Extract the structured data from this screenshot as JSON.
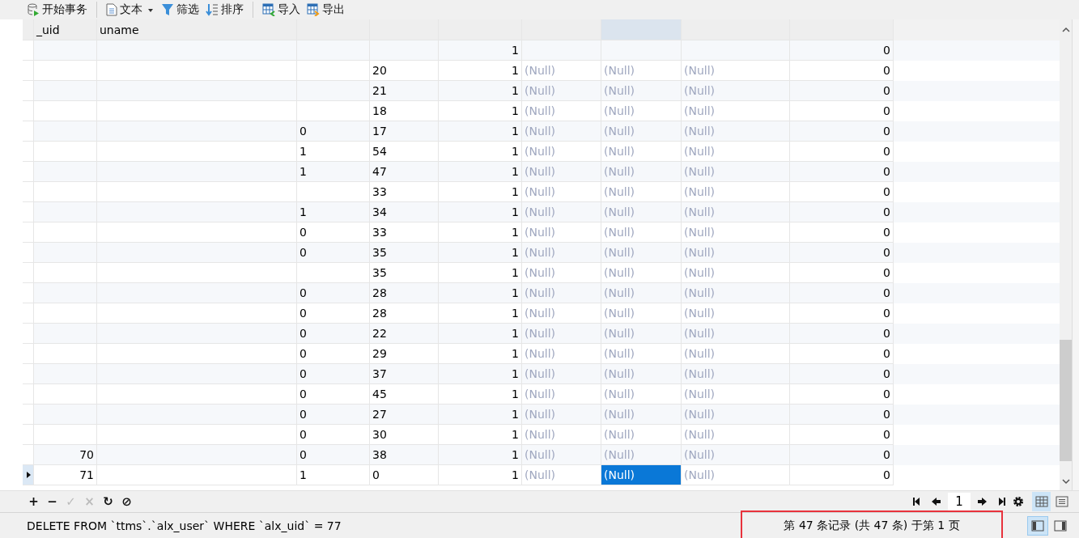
{
  "toolbar": [
    {
      "label": "开始事务"
    },
    {
      "label": "文本"
    },
    {
      "label": "筛选"
    },
    {
      "label": "排序"
    },
    {
      "label": "导入"
    },
    {
      "label": "导出"
    }
  ],
  "table": {
    "columns": [
      {
        "header": "_uid",
        "kind": "plain",
        "selected": false
      },
      {
        "header": "uname",
        "kind": "plain",
        "selected": false
      },
      {
        "kind": "plain",
        "selected": false
      },
      {
        "kind": "plain",
        "selected": false
      },
      {
        "kind": "plain",
        "selected": false
      },
      {
        "kind": "null",
        "selected": false
      },
      {
        "kind": "null",
        "selected": true
      },
      {
        "kind": "null",
        "selected": false
      },
      {
        "kind": "plain",
        "selected": false
      }
    ],
    "rows": [
      {
        "selected": false,
        "cells": [
          null,
          null,
          null,
          null,
          "1",
          null,
          null,
          null,
          "0"
        ]
      },
      {
        "selected": false,
        "cells": [
          null,
          null,
          null,
          "20",
          "1",
          "(Null)",
          "(Null)",
          "(Null)",
          "0"
        ]
      },
      {
        "selected": false,
        "cells": [
          null,
          null,
          null,
          "21",
          "1",
          "(Null)",
          "(Null)",
          "(Null)",
          "0"
        ]
      },
      {
        "selected": false,
        "cells": [
          null,
          null,
          null,
          "18",
          "1",
          "(Null)",
          "(Null)",
          "(Null)",
          "0"
        ]
      },
      {
        "selected": false,
        "cells": [
          null,
          null,
          "0",
          "17",
          "1",
          "(Null)",
          "(Null)",
          "(Null)",
          "0"
        ]
      },
      {
        "selected": false,
        "cells": [
          null,
          null,
          "1",
          "54",
          "1",
          "(Null)",
          "(Null)",
          "(Null)",
          "0"
        ]
      },
      {
        "selected": false,
        "cells": [
          null,
          null,
          "1",
          "47",
          "1",
          "(Null)",
          "(Null)",
          "(Null)",
          "0"
        ]
      },
      {
        "selected": false,
        "cells": [
          null,
          null,
          null,
          "33",
          "1",
          "(Null)",
          "(Null)",
          "(Null)",
          "0"
        ]
      },
      {
        "selected": false,
        "cells": [
          null,
          null,
          "1",
          "34",
          "1",
          "(Null)",
          "(Null)",
          "(Null)",
          "0"
        ]
      },
      {
        "selected": false,
        "cells": [
          null,
          null,
          "0",
          "33",
          "1",
          "(Null)",
          "(Null)",
          "(Null)",
          "0"
        ]
      },
      {
        "selected": false,
        "cells": [
          null,
          null,
          "0",
          "35",
          "1",
          "(Null)",
          "(Null)",
          "(Null)",
          "0"
        ]
      },
      {
        "selected": false,
        "cells": [
          null,
          null,
          null,
          "35",
          "1",
          "(Null)",
          "(Null)",
          "(Null)",
          "0"
        ]
      },
      {
        "selected": false,
        "cells": [
          null,
          null,
          "0",
          "28",
          "1",
          "(Null)",
          "(Null)",
          "(Null)",
          "0"
        ]
      },
      {
        "selected": false,
        "cells": [
          null,
          null,
          "0",
          "28",
          "1",
          "(Null)",
          "(Null)",
          "(Null)",
          "0"
        ]
      },
      {
        "selected": false,
        "cells": [
          null,
          null,
          "0",
          "22",
          "1",
          "(Null)",
          "(Null)",
          "(Null)",
          "0"
        ]
      },
      {
        "selected": false,
        "cells": [
          null,
          null,
          "0",
          "29",
          "1",
          "(Null)",
          "(Null)",
          "(Null)",
          "0"
        ]
      },
      {
        "selected": false,
        "cells": [
          null,
          null,
          "0",
          "37",
          "1",
          "(Null)",
          "(Null)",
          "(Null)",
          "0"
        ]
      },
      {
        "selected": false,
        "cells": [
          null,
          null,
          "0",
          "45",
          "1",
          "(Null)",
          "(Null)",
          "(Null)",
          "0"
        ]
      },
      {
        "selected": false,
        "cells": [
          null,
          null,
          "0",
          "27",
          "1",
          "(Null)",
          "(Null)",
          "(Null)",
          "0"
        ]
      },
      {
        "selected": false,
        "cells": [
          null,
          null,
          "0",
          "30",
          "1",
          "(Null)",
          "(Null)",
          "(Null)",
          "0"
        ]
      },
      {
        "selected": false,
        "cells": [
          "70",
          null,
          "0",
          "38",
          "1",
          "(Null)",
          "(Null)",
          "(Null)",
          "0"
        ]
      },
      {
        "selected": true,
        "cells": [
          "71",
          null,
          "1",
          "0",
          "1",
          "(Null)",
          "(Null)",
          "(Null)",
          "0"
        ]
      }
    ]
  },
  "record_tools": [
    {
      "glyph": "+",
      "disabled": false
    },
    {
      "glyph": "−",
      "disabled": false
    },
    {
      "glyph": "✓",
      "disabled": true
    },
    {
      "glyph": "×",
      "disabled": true
    },
    {
      "glyph": "↻",
      "disabled": false
    },
    {
      "glyph": "⊘",
      "disabled": false
    }
  ],
  "pager": {
    "page": "1"
  },
  "view_toggles": [
    {
      "kind": "grid",
      "selected": true
    },
    {
      "kind": "form",
      "selected": false
    }
  ],
  "status_bar": {
    "sql": "DELETE FROM `ttms`.`alx_user` WHERE `alx_uid` = 77",
    "records": "第 47 条记录 (共 47 条) 于第 1 页",
    "records_highlighted": true,
    "panel_toggles": [
      {
        "kind": "left",
        "selected": true
      },
      {
        "kind": "right",
        "selected": false
      }
    ]
  }
}
